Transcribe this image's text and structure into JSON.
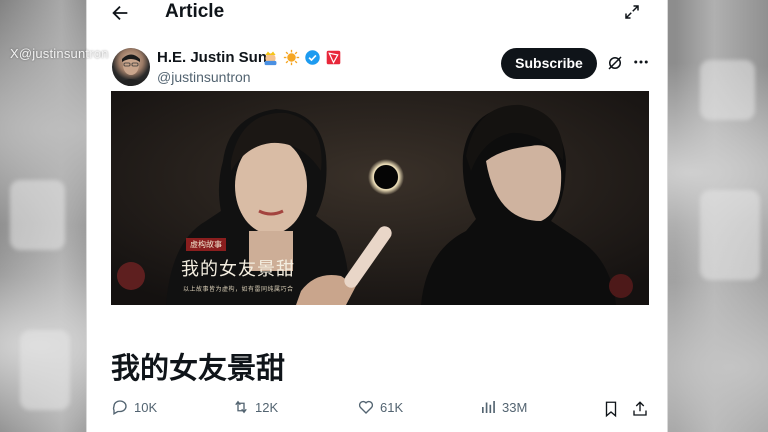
{
  "watermark": "X@justinsuntron",
  "header": {
    "title": "Article"
  },
  "author": {
    "name": "H.E. Justin Sun",
    "handle": "@justinsuntron",
    "badges": [
      "royal-emoji-icon",
      "sun-emoji-icon",
      "verified-badge-icon",
      "tron-logo-icon"
    ],
    "subscribe_label": "Subscribe"
  },
  "hero": {
    "tag": "虚构故事",
    "title": "我的女友景甜",
    "caption": "以上故事皆为虚构，如有雷同纯属巧合"
  },
  "article": {
    "title": "我的女友景甜"
  },
  "actions": {
    "replies": "10K",
    "reposts": "12K",
    "likes": "61K",
    "views": "33M"
  },
  "colors": {
    "text_primary": "#0f1419",
    "text_secondary": "#536471",
    "button_bg": "#0f1419",
    "verified": "#1d9bf0",
    "tron": "#e8273a"
  }
}
